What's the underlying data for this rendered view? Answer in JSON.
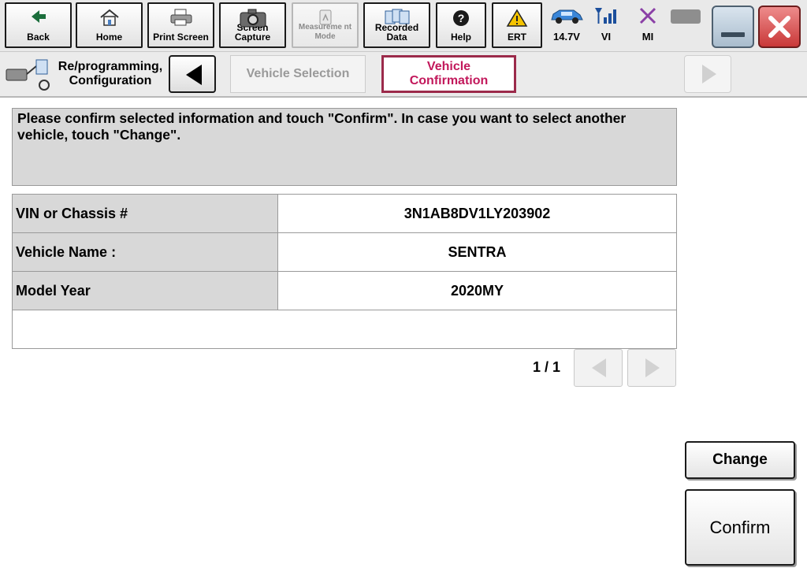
{
  "toolbar": {
    "buttons": [
      {
        "label": "Back",
        "icon": "back-arrow-icon"
      },
      {
        "label": "Home",
        "icon": "home-icon"
      },
      {
        "label": "Print Screen",
        "icon": "printer-icon"
      },
      {
        "label": "Screen Capture",
        "icon": "camera-icon"
      },
      {
        "label": "Measureme nt Mode",
        "icon": "measurement-icon",
        "disabled": true
      },
      {
        "label": "Recorded Data",
        "icon": "recorded-data-icon"
      },
      {
        "label": "Help",
        "icon": "help-icon"
      },
      {
        "label": "ERT",
        "icon": "warning-icon"
      }
    ],
    "status": [
      {
        "label": "14.7V",
        "icon": "car-battery-icon"
      },
      {
        "label": "VI",
        "icon": "signal-icon"
      },
      {
        "label": "MI",
        "icon": "mi-x-icon"
      }
    ],
    "window": {
      "minimize": "minimize-icon",
      "close": "close-icon"
    }
  },
  "breadcrumb": {
    "title_line1": "Re/programming,",
    "title_line2": "Configuration",
    "steps": [
      {
        "label": "Vehicle Selection",
        "active": false
      },
      {
        "line1": "Vehicle",
        "line2": "Confirmation",
        "active": true
      }
    ]
  },
  "message": "Please confirm selected information and touch \"Confirm\". In case you want to select another vehicle, touch \"Change\".",
  "vehicle_info": {
    "rows": [
      {
        "label": "VIN or Chassis #",
        "value": "3N1AB8DV1LY203902"
      },
      {
        "label": "Vehicle Name :",
        "value": "SENTRA"
      },
      {
        "label": "Model Year",
        "value": "2020MY"
      }
    ]
  },
  "pager": {
    "text": "1 / 1"
  },
  "actions": {
    "change": "Change",
    "confirm": "Confirm"
  },
  "colors": {
    "accent": "#c2185b",
    "active_border": "#9b2a4a",
    "panel_gray": "#d8d8d8"
  }
}
